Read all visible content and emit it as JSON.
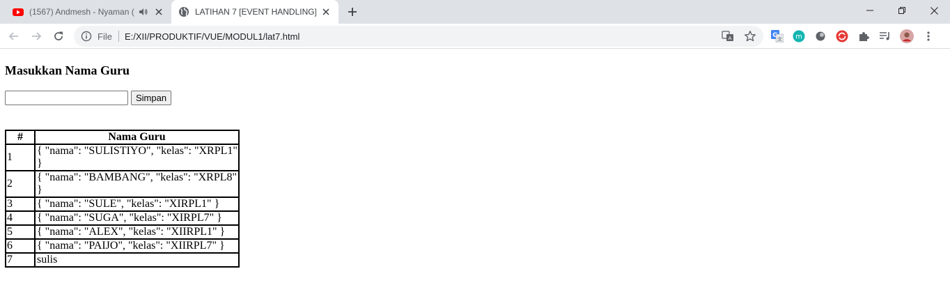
{
  "tabs": [
    {
      "title": "(1567) Andmesh - Nyaman (",
      "active": false,
      "favicon": "youtube-icon",
      "audio": true
    },
    {
      "title": "LATIHAN 7 [EVENT HANDLING]",
      "active": true,
      "favicon": "globe-icon",
      "audio": false
    }
  ],
  "toolbar": {
    "file_label": "File",
    "url": "E:/XII/PRODUKTIF/VUE/MODUL1/lat7.html"
  },
  "page": {
    "heading": "Masukkan Nama Guru",
    "input_value": "",
    "button_label": "Simpan",
    "table": {
      "headers": [
        "#",
        "Nama Guru"
      ],
      "rows": [
        {
          "no": "1",
          "value": "{ \"nama\": \"SULISTIYO\", \"kelas\": \"XRPL1\" }"
        },
        {
          "no": "2",
          "value": "{ \"nama\": \"BAMBANG\", \"kelas\": \"XRPL8\" }"
        },
        {
          "no": "3",
          "value": "{ \"nama\": \"SULE\", \"kelas\": \"XIRPL1\" }"
        },
        {
          "no": "4",
          "value": "{ \"nama\": \"SUGA\", \"kelas\": \"XIRPL7\" }"
        },
        {
          "no": "5",
          "value": "{ \"nama\": \"ALEX\", \"kelas\": \"XIIRPL1\" }"
        },
        {
          "no": "6",
          "value": "{ \"nama\": \"PAIJO\", \"kelas\": \"XIIRPL7\" }"
        },
        {
          "no": "7",
          "value": "sulis"
        }
      ]
    }
  },
  "colors": {
    "tabstrip_bg": "#dee1e6",
    "omnibox_bg": "#f1f3f4",
    "youtube_red": "#ff0000"
  }
}
